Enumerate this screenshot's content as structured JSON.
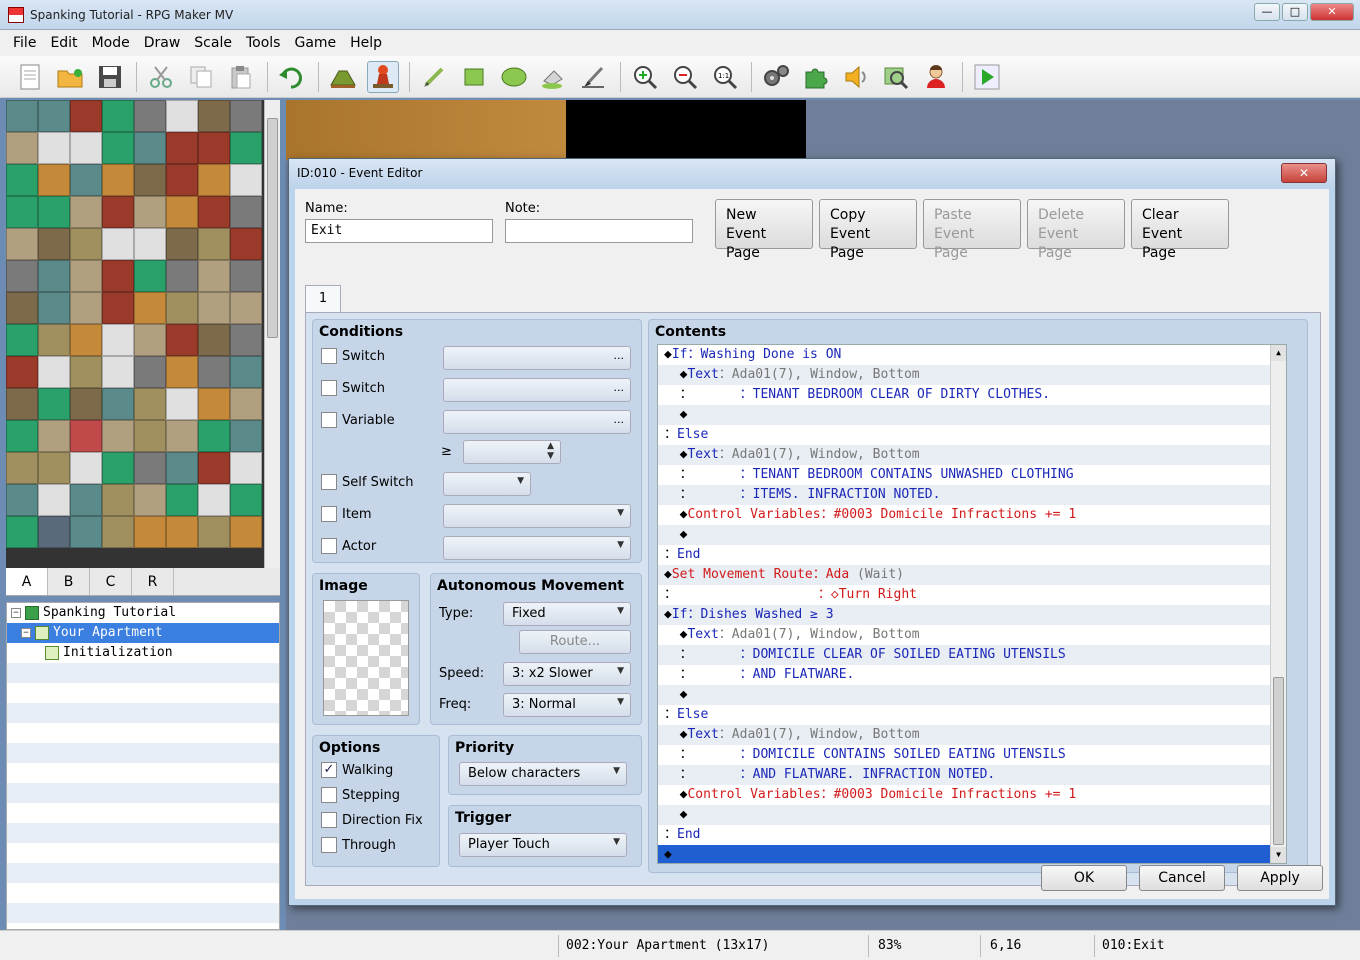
{
  "window": {
    "title": "Spanking Tutorial - RPG Maker MV"
  },
  "menu": [
    "File",
    "Edit",
    "Mode",
    "Draw",
    "Scale",
    "Tools",
    "Game",
    "Help"
  ],
  "toolbar": {
    "icons": [
      "new-project-icon",
      "open-project-icon",
      "save-project-icon",
      "cut-icon",
      "copy-icon",
      "paste-icon",
      "undo-icon",
      "map-mode-icon",
      "event-mode-icon",
      "pencil-icon",
      "rectangle-icon",
      "ellipse-icon",
      "fill-icon",
      "shadow-pen-icon",
      "zoom-in-icon",
      "zoom-out-icon",
      "zoom-actual-icon",
      "database-icon",
      "plugin-manager-icon",
      "sound-test-icon",
      "event-searcher-icon",
      "character-generator-icon",
      "playtest-icon"
    ]
  },
  "tileset_tabs": [
    "A",
    "B",
    "C",
    "R"
  ],
  "map_tree": [
    {
      "label": "Spanking Tutorial",
      "level": 0
    },
    {
      "label": "Your Apartment",
      "level": 1
    },
    {
      "label": "Initialization",
      "level": 2
    }
  ],
  "status": {
    "map": "002:Your Apartment (13x17)",
    "zoom": "83%",
    "coords": "6,16",
    "event": "010:Exit"
  },
  "dialog": {
    "title": "ID:010 - Event Editor",
    "close": "✕",
    "name_label": "Name:",
    "name_value": "Exit",
    "note_label": "Note:",
    "note_value": "",
    "page_buttons": [
      {
        "line1": "New",
        "line2": "Event Page",
        "enabled": true
      },
      {
        "line1": "Copy",
        "line2": "Event Page",
        "enabled": true
      },
      {
        "line1": "Paste",
        "line2": "Event Page",
        "enabled": false
      },
      {
        "line1": "Delete",
        "line2": "Event Page",
        "enabled": false
      },
      {
        "line1": "Clear",
        "line2": "Event Page",
        "enabled": true
      }
    ],
    "page_tab": "1",
    "conditions": {
      "title": "Conditions",
      "switch1": "Switch",
      "switch2": "Switch",
      "variable": "Variable",
      "gte": "≥",
      "self_switch": "Self Switch",
      "item": "Item",
      "actor": "Actor",
      "dots": "..."
    },
    "image": {
      "title": "Image"
    },
    "movement": {
      "title": "Autonomous Movement",
      "type_label": "Type:",
      "type_value": "Fixed",
      "route_button": "Route...",
      "speed_label": "Speed:",
      "speed_value": "3: x2 Slower",
      "freq_label": "Freq:",
      "freq_value": "3: Normal"
    },
    "options": {
      "title": "Options",
      "walking": "Walking",
      "walking_checked": "✓",
      "stepping": "Stepping",
      "direction_fix": "Direction Fix",
      "through": "Through"
    },
    "priority": {
      "title": "Priority",
      "value": "Below characters"
    },
    "trigger": {
      "title": "Trigger",
      "value": "Player Touch"
    },
    "contents": {
      "title": "Contents",
      "rows": [
        [
          {
            "t": "◆",
            "c": "c-black"
          },
          {
            "t": "If",
            "c": "c-blue"
          },
          {
            "t": "：Washing Done is ON",
            "c": "c-blue"
          }
        ],
        [
          {
            "t": "  ◆",
            "c": "c-black"
          },
          {
            "t": "Text",
            "c": "c-blue"
          },
          {
            "t": "：Ada01(7), Window, Bottom",
            "c": "c-gray"
          }
        ],
        [
          {
            "t": "  ：      ",
            "c": "c-black"
          },
          {
            "t": "：TENANT BEDROOM CLEAR OF DIRTY CLOTHES.",
            "c": "c-blue"
          }
        ],
        [
          {
            "t": "  ◆",
            "c": "c-black"
          }
        ],
        [
          {
            "t": "：",
            "c": "c-black"
          },
          {
            "t": "Else",
            "c": "c-blue"
          }
        ],
        [
          {
            "t": "  ◆",
            "c": "c-black"
          },
          {
            "t": "Text",
            "c": "c-blue"
          },
          {
            "t": "：Ada01(7), Window, Bottom",
            "c": "c-gray"
          }
        ],
        [
          {
            "t": "  ：      ",
            "c": "c-black"
          },
          {
            "t": "：TENANT BEDROOM CONTAINS UNWASHED CLOTHING",
            "c": "c-blue"
          }
        ],
        [
          {
            "t": "  ：      ",
            "c": "c-black"
          },
          {
            "t": "：ITEMS. INFRACTION NOTED.",
            "c": "c-blue"
          }
        ],
        [
          {
            "t": "  ◆",
            "c": "c-black"
          },
          {
            "t": "Control Variables：#0003 Domicile Infractions += 1",
            "c": "c-red"
          }
        ],
        [
          {
            "t": "  ◆",
            "c": "c-black"
          }
        ],
        [
          {
            "t": "：",
            "c": "c-black"
          },
          {
            "t": "End",
            "c": "c-blue"
          }
        ],
        [
          {
            "t": "◆",
            "c": "c-black"
          },
          {
            "t": "Set Movement Route：Ada ",
            "c": "c-red"
          },
          {
            "t": "(Wait)",
            "c": "c-gray"
          }
        ],
        [
          {
            "t": "：                  ",
            "c": "c-black"
          },
          {
            "t": "：◇Turn Right",
            "c": "c-red"
          }
        ],
        [
          {
            "t": "◆",
            "c": "c-black"
          },
          {
            "t": "If：Dishes Washed ≥ 3",
            "c": "c-blue"
          }
        ],
        [
          {
            "t": "  ◆",
            "c": "c-black"
          },
          {
            "t": "Text",
            "c": "c-blue"
          },
          {
            "t": "：Ada01(7), Window, Bottom",
            "c": "c-gray"
          }
        ],
        [
          {
            "t": "  ：      ",
            "c": "c-black"
          },
          {
            "t": "：DOMICILE CLEAR OF SOILED EATING UTENSILS",
            "c": "c-blue"
          }
        ],
        [
          {
            "t": "  ：      ",
            "c": "c-black"
          },
          {
            "t": "：AND FLATWARE.",
            "c": "c-blue"
          }
        ],
        [
          {
            "t": "  ◆",
            "c": "c-black"
          }
        ],
        [
          {
            "t": "：",
            "c": "c-black"
          },
          {
            "t": "Else",
            "c": "c-blue"
          }
        ],
        [
          {
            "t": "  ◆",
            "c": "c-black"
          },
          {
            "t": "Text",
            "c": "c-blue"
          },
          {
            "t": "：Ada01(7), Window, Bottom",
            "c": "c-gray"
          }
        ],
        [
          {
            "t": "  ：      ",
            "c": "c-black"
          },
          {
            "t": "：DOMICILE CONTAINS SOILED EATING UTENSILS",
            "c": "c-blue"
          }
        ],
        [
          {
            "t": "  ：      ",
            "c": "c-black"
          },
          {
            "t": "：AND FLATWARE. INFRACTION NOTED.",
            "c": "c-blue"
          }
        ],
        [
          {
            "t": "  ◆",
            "c": "c-black"
          },
          {
            "t": "Control Variables：#0003 Domicile Infractions += 1",
            "c": "c-red"
          }
        ],
        [
          {
            "t": "  ◆",
            "c": "c-black"
          }
        ],
        [
          {
            "t": "：",
            "c": "c-black"
          },
          {
            "t": "End",
            "c": "c-blue"
          }
        ],
        [
          {
            "t": "◆",
            "c": "c-black"
          }
        ]
      ]
    },
    "buttons": {
      "ok": "OK",
      "cancel": "Cancel",
      "apply": "Apply"
    }
  }
}
